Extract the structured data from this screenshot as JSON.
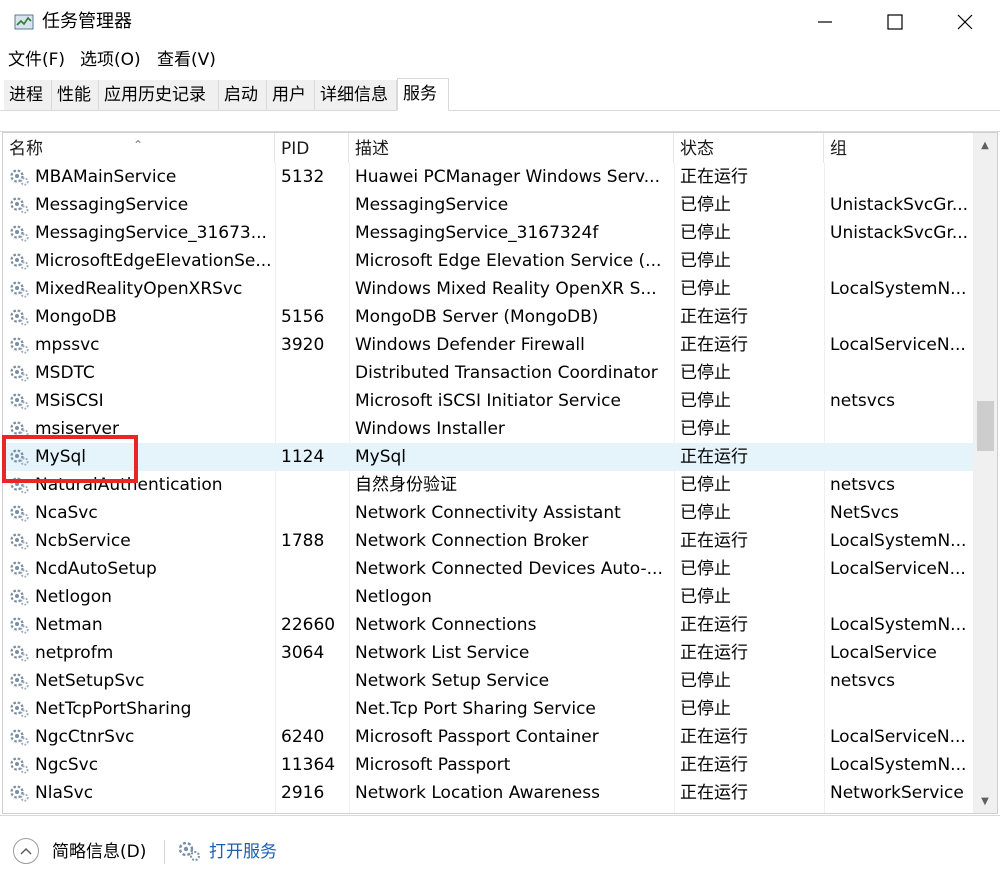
{
  "window": {
    "title": "任务管理器",
    "minimize": "minimize",
    "maximize": "maximize",
    "close": "close"
  },
  "menu": [
    "文件(F)",
    "选项(O)",
    "查看(V)"
  ],
  "tabs": [
    "进程",
    "性能",
    "应用历史记录",
    "启动",
    "用户",
    "详细信息",
    "服务"
  ],
  "active_tab": "服务",
  "columns": [
    "名称",
    "PID",
    "描述",
    "状态",
    "组"
  ],
  "rows": [
    {
      "name": "MBAMainService",
      "pid": "5132",
      "desc": "Huawei PCManager Windows Serv...",
      "status": "正在运行",
      "group": ""
    },
    {
      "name": "MessagingService",
      "pid": "",
      "desc": "MessagingService",
      "status": "已停止",
      "group": "UnistackSvcGr..."
    },
    {
      "name": "MessagingService_31673...",
      "pid": "",
      "desc": "MessagingService_3167324f",
      "status": "已停止",
      "group": "UnistackSvcGr..."
    },
    {
      "name": "MicrosoftEdgeElevationSe...",
      "pid": "",
      "desc": "Microsoft Edge Elevation Service (...",
      "status": "已停止",
      "group": ""
    },
    {
      "name": "MixedRealityOpenXRSvc",
      "pid": "",
      "desc": "Windows Mixed Reality OpenXR S...",
      "status": "已停止",
      "group": "LocalSystemN..."
    },
    {
      "name": "MongoDB",
      "pid": "5156",
      "desc": "MongoDB Server (MongoDB)",
      "status": "正在运行",
      "group": ""
    },
    {
      "name": "mpssvc",
      "pid": "3920",
      "desc": "Windows Defender Firewall",
      "status": "正在运行",
      "group": "LocalServiceN..."
    },
    {
      "name": "MSDTC",
      "pid": "",
      "desc": "Distributed Transaction Coordinator",
      "status": "已停止",
      "group": ""
    },
    {
      "name": "MSiSCSI",
      "pid": "",
      "desc": "Microsoft iSCSI Initiator Service",
      "status": "已停止",
      "group": "netsvcs"
    },
    {
      "name": "msiserver",
      "pid": "",
      "desc": "Windows Installer",
      "status": "已停止",
      "group": ""
    },
    {
      "name": "MySql",
      "pid": "1124",
      "desc": "MySql",
      "status": "正在运行",
      "group": ""
    },
    {
      "name": "NaturalAuthentication",
      "pid": "",
      "desc": "自然身份验证",
      "status": "已停止",
      "group": "netsvcs"
    },
    {
      "name": "NcaSvc",
      "pid": "",
      "desc": "Network Connectivity Assistant",
      "status": "已停止",
      "group": "NetSvcs"
    },
    {
      "name": "NcbService",
      "pid": "1788",
      "desc": "Network Connection Broker",
      "status": "正在运行",
      "group": "LocalSystemN..."
    },
    {
      "name": "NcdAutoSetup",
      "pid": "",
      "desc": "Network Connected Devices Auto-...",
      "status": "已停止",
      "group": "LocalServiceN..."
    },
    {
      "name": "Netlogon",
      "pid": "",
      "desc": "Netlogon",
      "status": "已停止",
      "group": ""
    },
    {
      "name": "Netman",
      "pid": "22660",
      "desc": "Network Connections",
      "status": "正在运行",
      "group": "LocalSystemN..."
    },
    {
      "name": "netprofm",
      "pid": "3064",
      "desc": "Network List Service",
      "status": "正在运行",
      "group": "LocalService"
    },
    {
      "name": "NetSetupSvc",
      "pid": "",
      "desc": "Network Setup Service",
      "status": "已停止",
      "group": "netsvcs"
    },
    {
      "name": "NetTcpPortSharing",
      "pid": "",
      "desc": "Net.Tcp Port Sharing Service",
      "status": "已停止",
      "group": ""
    },
    {
      "name": "NgcCtnrSvc",
      "pid": "6240",
      "desc": "Microsoft Passport Container",
      "status": "正在运行",
      "group": "LocalServiceN..."
    },
    {
      "name": "NgcSvc",
      "pid": "11364",
      "desc": "Microsoft Passport",
      "status": "正在运行",
      "group": "LocalSystemN..."
    },
    {
      "name": "NlaSvc",
      "pid": "2916",
      "desc": "Network Location Awareness",
      "status": "正在运行",
      "group": "NetworkService"
    }
  ],
  "selected_service": "MySql",
  "footer": {
    "summary_label": "简略信息(D)",
    "open_services_label": "打开服务"
  },
  "colors": {
    "selection": "#e5f3fb",
    "highlight_box": "#e8262a",
    "link": "#1a5fb4",
    "icon_gear": "#7a8fa6"
  }
}
